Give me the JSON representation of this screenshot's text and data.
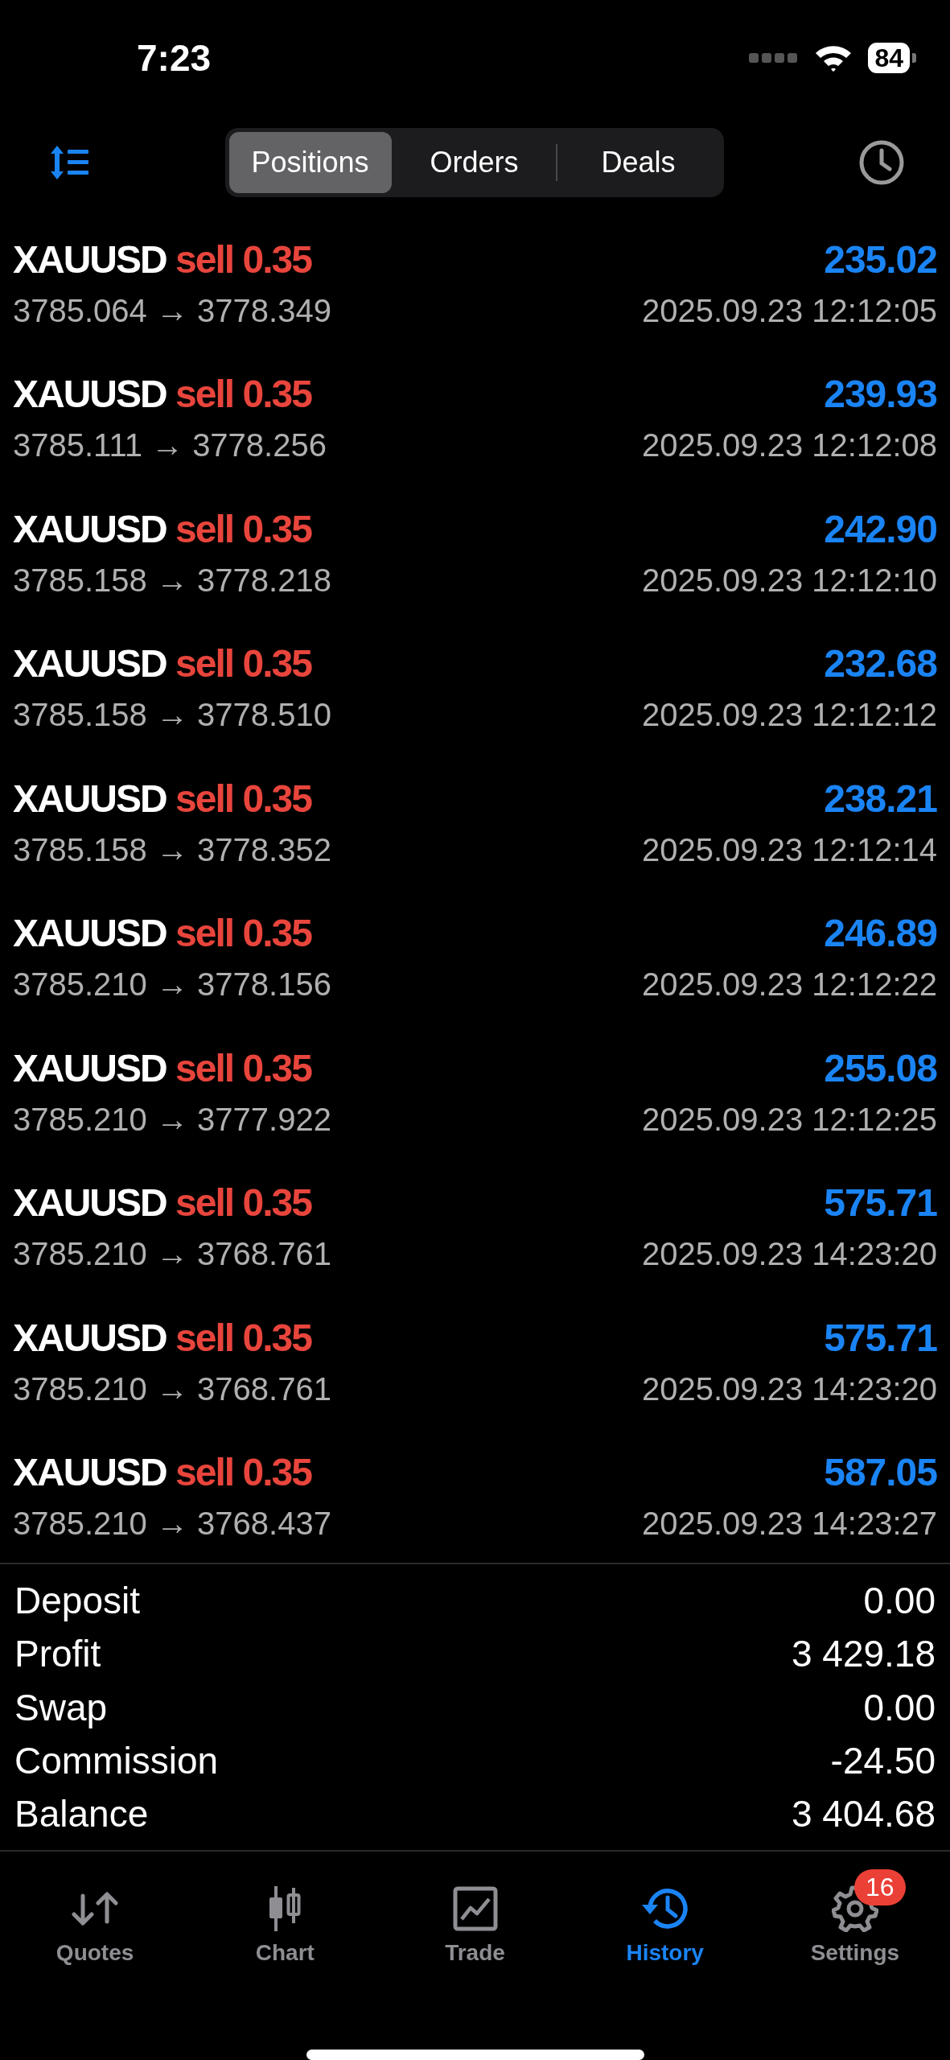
{
  "status_bar": {
    "time": "7:23",
    "battery": "84"
  },
  "tabs": [
    {
      "label": "Positions",
      "selected": true
    },
    {
      "label": "Orders",
      "selected": false
    },
    {
      "label": "Deals",
      "selected": false
    }
  ],
  "trades": [
    {
      "symbol": "XAUUSD",
      "side": "sell",
      "volume": "0.35",
      "open_price": "3785.064",
      "close_price": "3778.349",
      "arrow": "→",
      "profit": "235.02",
      "time": "2025.09.23 12:12:05"
    },
    {
      "symbol": "XAUUSD",
      "side": "sell",
      "volume": "0.35",
      "open_price": "3785.111",
      "close_price": "3778.256",
      "arrow": "→",
      "profit": "239.93",
      "time": "2025.09.23 12:12:08"
    },
    {
      "symbol": "XAUUSD",
      "side": "sell",
      "volume": "0.35",
      "open_price": "3785.158",
      "close_price": "3778.218",
      "arrow": "→",
      "profit": "242.90",
      "time": "2025.09.23 12:12:10"
    },
    {
      "symbol": "XAUUSD",
      "side": "sell",
      "volume": "0.35",
      "open_price": "3785.158",
      "close_price": "3778.510",
      "arrow": "→",
      "profit": "232.68",
      "time": "2025.09.23 12:12:12"
    },
    {
      "symbol": "XAUUSD",
      "side": "sell",
      "volume": "0.35",
      "open_price": "3785.158",
      "close_price": "3778.352",
      "arrow": "→",
      "profit": "238.21",
      "time": "2025.09.23 12:12:14"
    },
    {
      "symbol": "XAUUSD",
      "side": "sell",
      "volume": "0.35",
      "open_price": "3785.210",
      "close_price": "3778.156",
      "arrow": "→",
      "profit": "246.89",
      "time": "2025.09.23 12:12:22"
    },
    {
      "symbol": "XAUUSD",
      "side": "sell",
      "volume": "0.35",
      "open_price": "3785.210",
      "close_price": "3777.922",
      "arrow": "→",
      "profit": "255.08",
      "time": "2025.09.23 12:12:25"
    },
    {
      "symbol": "XAUUSD",
      "side": "sell",
      "volume": "0.35",
      "open_price": "3785.210",
      "close_price": "3768.761",
      "arrow": "→",
      "profit": "575.71",
      "time": "2025.09.23 14:23:20"
    },
    {
      "symbol": "XAUUSD",
      "side": "sell",
      "volume": "0.35",
      "open_price": "3785.210",
      "close_price": "3768.761",
      "arrow": "→",
      "profit": "575.71",
      "time": "2025.09.23 14:23:20"
    },
    {
      "symbol": "XAUUSD",
      "side": "sell",
      "volume": "0.35",
      "open_price": "3785.210",
      "close_price": "3768.437",
      "arrow": "→",
      "profit": "587.05",
      "time": "2025.09.23 14:23:27"
    }
  ],
  "summary": [
    {
      "label": "Deposit",
      "value": "0.00"
    },
    {
      "label": "Profit",
      "value": "3 429.18"
    },
    {
      "label": "Swap",
      "value": "0.00"
    },
    {
      "label": "Commission",
      "value": "-24.50"
    },
    {
      "label": "Balance",
      "value": "3 404.68"
    }
  ],
  "nav": [
    {
      "label": "Quotes",
      "kind": "quotes",
      "selected": false
    },
    {
      "label": "Chart",
      "kind": "chart",
      "selected": false
    },
    {
      "label": "Trade",
      "kind": "trade",
      "selected": false
    },
    {
      "label": "History",
      "kind": "history",
      "selected": true
    },
    {
      "label": "Settings",
      "kind": "settings",
      "selected": false,
      "badge": "16"
    }
  ]
}
